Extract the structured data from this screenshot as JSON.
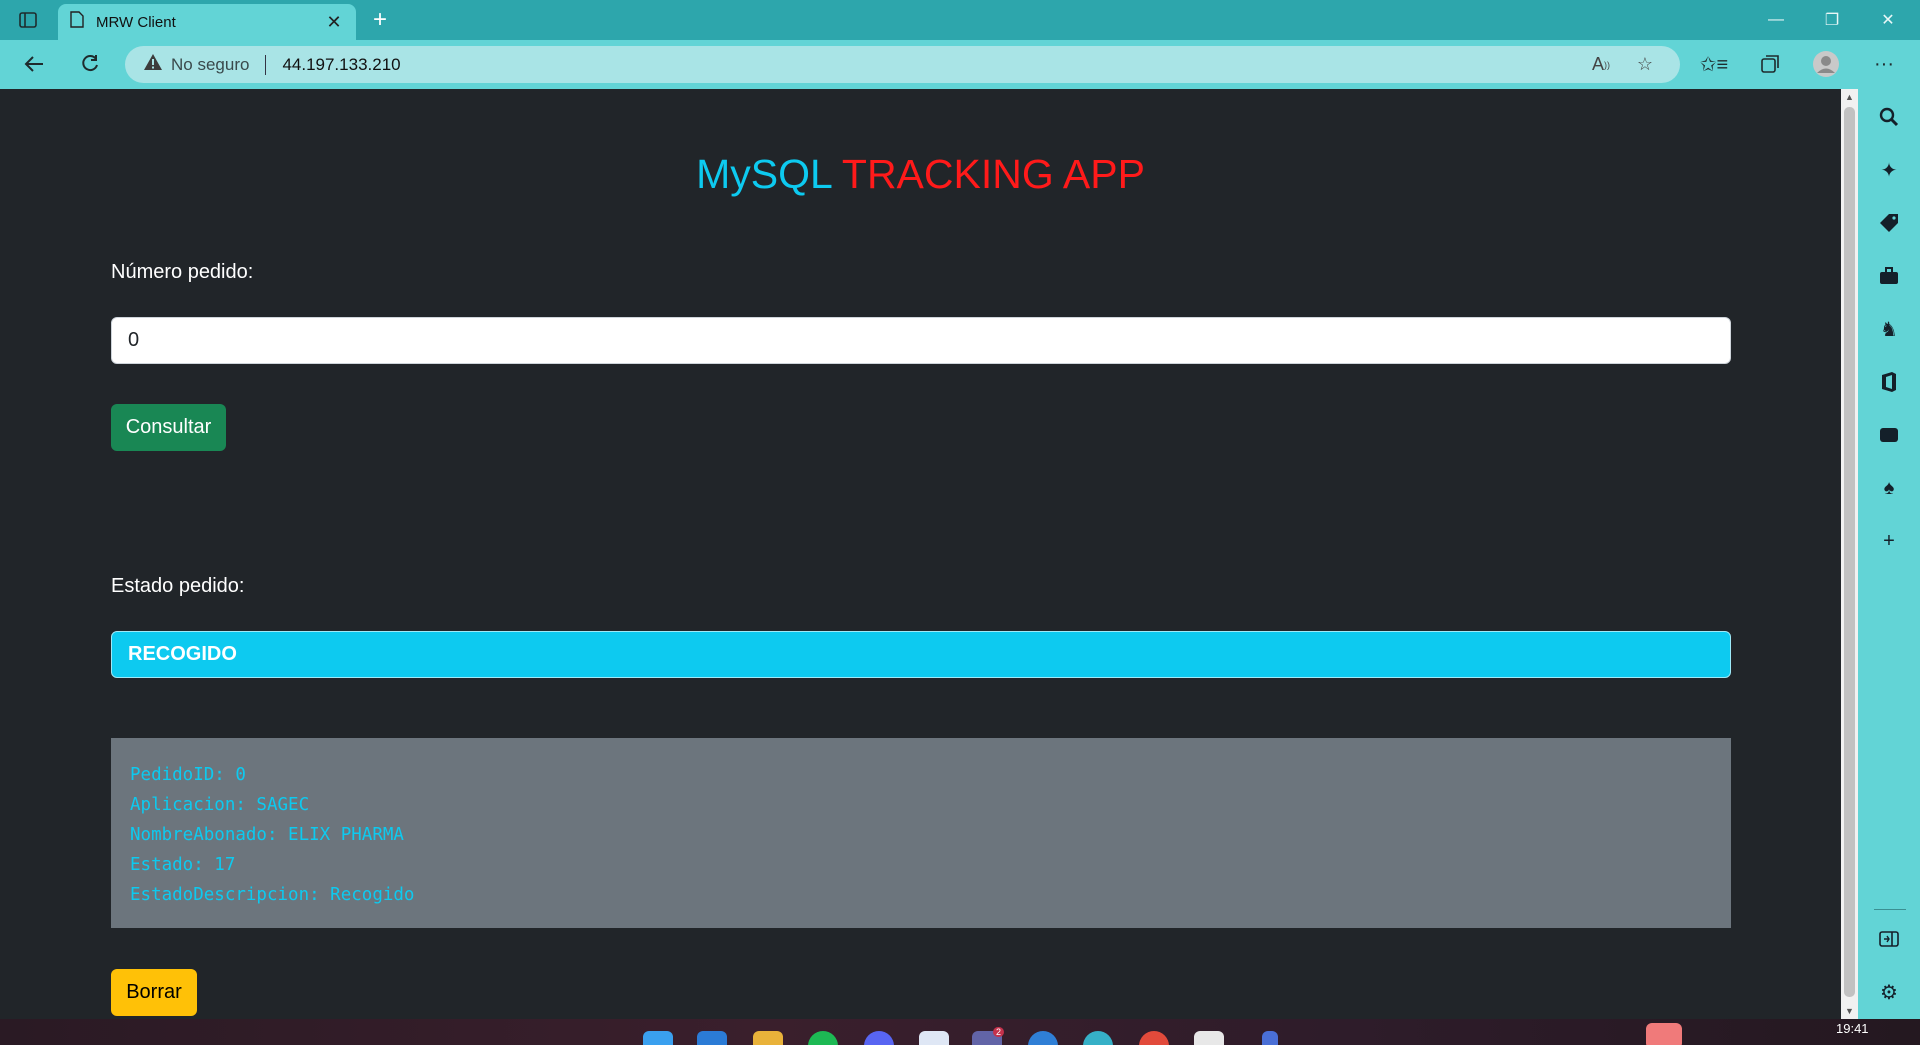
{
  "browser": {
    "tab_title": "MRW Client",
    "new_tab": "+",
    "address": {
      "security_label": "No seguro",
      "url": "44.197.133.210"
    }
  },
  "app": {
    "title_part1": "MySQL",
    "title_part2": "TRACKING APP",
    "order_label": "Número pedido:",
    "order_value": "0",
    "query_button": "Consultar",
    "status_label": "Estado pedido:",
    "status_value": "RECOGIDO",
    "details": [
      "PedidoID: 0",
      "Aplicacion: SAGEC",
      "NombreAbonado: ELIX PHARMA",
      "Estado: 17",
      "EstadoDescripcion: Recogido"
    ],
    "clear_button": "Borrar"
  },
  "taskbar": {
    "clock": "19:41",
    "teams_badge": "2"
  },
  "colors": {
    "page_bg": "#212529",
    "title_mysql": "#0dcaf0",
    "title_tracking": "#ff1a1a",
    "consultar": "#198754",
    "status": "#0dcaf0",
    "details_bg": "#6c757d",
    "borrar": "#ffc107",
    "browser_accent": "#62d4d6"
  }
}
